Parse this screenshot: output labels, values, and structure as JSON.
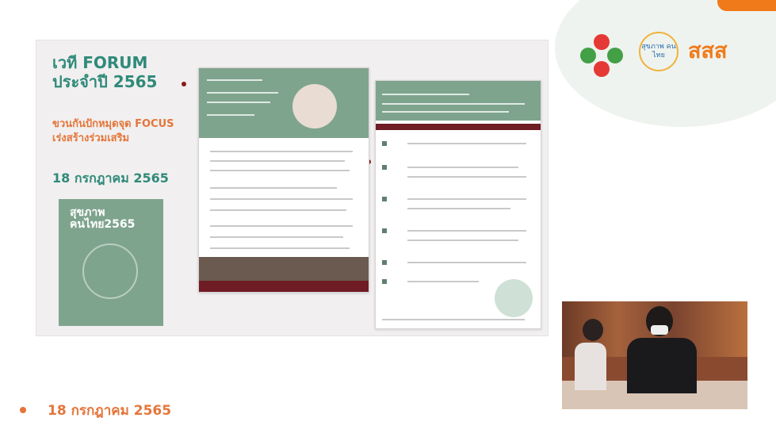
{
  "slide": {
    "title_line1": "เวที FORUM",
    "title_line2": "ประจำปี 2565",
    "subtitle_line1": "ขวนกันปักหมุดจุด FOCUS",
    "subtitle_line2": "เร่งสร้างร่วมเสริม",
    "date": "18 กรกฎาคม 2565",
    "book_label_line1": "สุขภาพ",
    "book_label_line2": "คนไทย2565"
  },
  "logos": {
    "circle_text": "สุขภาพ คนไทย",
    "sss_text": "สสส"
  },
  "bullet": {
    "date": "18 กรกฎาคม 2565"
  },
  "colors": {
    "teal": "#2f8a7a",
    "orange": "#e4753a",
    "sage": "#7fa48e",
    "maroon": "#6f1c25"
  }
}
